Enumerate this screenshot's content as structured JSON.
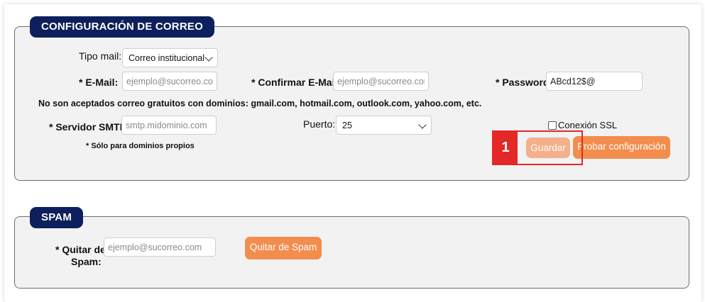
{
  "mail_config": {
    "legend": "CONFIGURACIÓN DE CORREO",
    "tipo_mail_label": "Tipo mail:",
    "tipo_mail_value": "Correo institucional",
    "email_label": "* E-Mail:",
    "email_placeholder": "ejemplo@sucorreo.com",
    "confirm_email_label": "* Confirmar E-Mail:",
    "confirm_email_placeholder": "ejemplo@sucorreo.com",
    "password_label": "* Password:",
    "password_value": "ABcd12$@",
    "notice": "No son aceptados correo gratuitos con dominios: gmail.com, hotmail.com, outlook.com, yahoo.com, etc.",
    "smtp_label": "* Servidor SMTP:",
    "smtp_placeholder": "smtp.midominio.com",
    "smtp_note": "* Sólo para dominios propios",
    "puerto_label": "Puerto:",
    "puerto_value": "25",
    "ssl_label": "Conexión SSL",
    "save_label": "Guardar",
    "test_label": "Probar configuración"
  },
  "annotation": {
    "badge": "1",
    "color": "#e42828"
  },
  "spam": {
    "legend": "SPAM",
    "remove_label_line1": "* Quitar de",
    "remove_label_line2": "Spam:",
    "remove_placeholder": "ejemplo@sucorreo.com",
    "remove_button": "Quitar de Spam"
  },
  "colors": {
    "legend_bg": "#0d1f5c",
    "button_bg": "#f28d4e",
    "panel_bg": "#f2f2f2"
  }
}
